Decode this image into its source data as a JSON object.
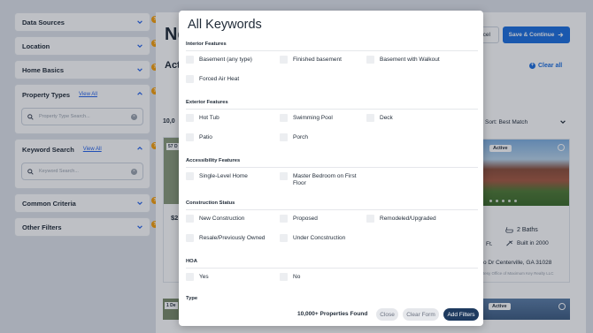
{
  "sidebar": {
    "data_sources": "Data Sources",
    "location": "Location",
    "home_basics": "Home Basics",
    "property_types": {
      "label": "Property Types",
      "link": "View All",
      "placeholder": "Property Type Search..."
    },
    "keyword_search": {
      "label": "Keyword Search",
      "link": "View All",
      "placeholder": "Keyword Search..."
    },
    "common_criteria": "Common Criteria",
    "other_filters": "Other Filters",
    "badge": "?"
  },
  "background": {
    "title_fragment": "Ne",
    "active_fragment": "Acti",
    "count_fragment": "10,0",
    "cancel_fragment": "ncel",
    "save_continue": "Save & Continue",
    "clear_all": "Clear all",
    "sort_label": "Sort:",
    "sort_value": "Best Match",
    "card_left_tag": "57 D",
    "card_left_price": "$2",
    "card_right_tag": "Active",
    "baths": "2 Baths",
    "built": "Built in 2000",
    "ft": "Ft.",
    "address": "o Dr Centerville, GA 31028",
    "office": "tesy Office of Maximum Key Realty LLC",
    "bottom_left_tag": "1 De",
    "bottom_right_tag": "Active"
  },
  "modal": {
    "title": "All Keywords",
    "sections": {
      "interior": {
        "title": "Interior Features",
        "options": [
          "Basement (any type)",
          "Finished basement",
          "Basement with Walkout",
          "Forced Air Heat"
        ]
      },
      "exterior": {
        "title": "Exterior Features",
        "options": [
          "Hot Tub",
          "Swimming Pool",
          "Deck",
          "Patio",
          "Porch"
        ]
      },
      "accessibility": {
        "title": "Accessibility Features",
        "options": [
          "Single-Level Home",
          "Master Bedroom on First Floor"
        ]
      },
      "construction": {
        "title": "Construction Status",
        "options": [
          "New Construction",
          "Proposed",
          "Remodeled/Upgraded",
          "Resale/Previously Owned",
          "Under Concstruction"
        ]
      },
      "hoa": {
        "title": "HOA",
        "options": [
          "Yes",
          "No"
        ]
      },
      "type": {
        "title": "Type"
      }
    },
    "footer": {
      "found": "10,000+ Properties Found",
      "close": "Close",
      "clear_form": "Clear Form",
      "add_filters": "Add Filters"
    }
  },
  "colors": {
    "primary": "#1d6fe0",
    "badge": "#f59e0b",
    "add_filters": "#1e3a5f"
  }
}
